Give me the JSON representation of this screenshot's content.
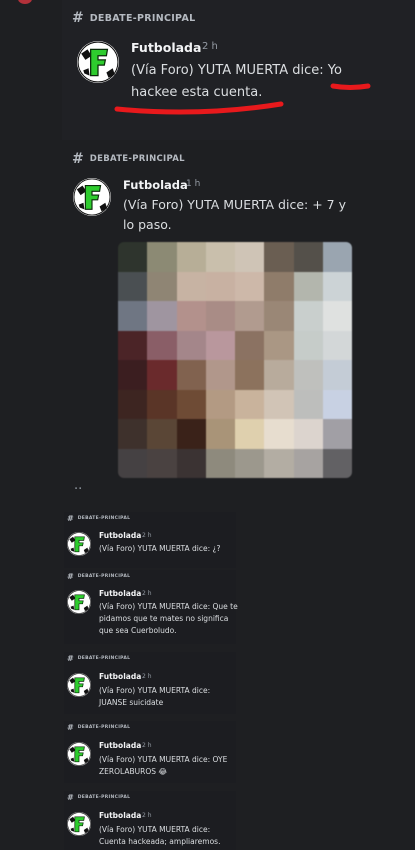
{
  "channel_label": "DEBATE-PRINCIPAL",
  "hash_icon": "#",
  "author": "Futbolada",
  "messages": [
    {
      "time": "2 h",
      "text_before": "(Vía Foro) YUTA MUERTA dice: ",
      "highlight": "Yo hackee esta cuenta."
    },
    {
      "time": "1 h",
      "text": "(Vía Foro) YUTA MUERTA dice: + 7 y lo paso."
    },
    {
      "time": "2 h",
      "text": "(Vía Foro) YUTA MUERTA dice: ¿?"
    },
    {
      "time": "2 h",
      "text": "(Vía Foro) YUTA MUERTA dice: Que te pidamos que te mates no significa que sea Cuerboludo."
    },
    {
      "time": "2 h",
      "text": "(Vía Foro) YUTA MUERTA dice: JUANSE suicidate"
    },
    {
      "time": "2 h",
      "text": "(Vía Foro) YUTA MUERTA dice: OYE ZEROLABUROS 😂"
    },
    {
      "time": "2 h",
      "text": "(Vía Foro) YUTA MUERTA dice: Cuenta hackeada; ampliaremos."
    }
  ],
  "ellipsis": "..",
  "colors": {
    "background": "#1e1f22",
    "text": "#dbdee1",
    "muted": "#949ba4",
    "annotation": "#e8191c",
    "logo_green": "#2ecc2e"
  },
  "icons": {
    "avatar": "futbolada-logo",
    "image": "pixelated-image"
  }
}
